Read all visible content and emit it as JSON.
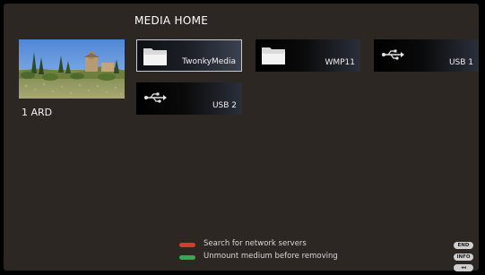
{
  "header": {
    "title": "MEDIA HOME"
  },
  "preview": {
    "channel_label": "1  ARD"
  },
  "sources": [
    {
      "label": "TwonkyMedia",
      "icon": "folder-icon",
      "selected": true
    },
    {
      "label": "WMP11",
      "icon": "folder-icon",
      "selected": false
    },
    {
      "label": "USB 1",
      "icon": "usb-icon",
      "selected": false
    },
    {
      "label": "USB 2",
      "icon": "usb-icon",
      "selected": false
    }
  ],
  "legend": {
    "red": {
      "color": "#d83a2e",
      "text": "Search for network servers"
    },
    "green": {
      "color": "#34a853",
      "text": "Unmount medium before removing"
    }
  },
  "keys": {
    "end": "END",
    "info": "INFO",
    "back": "◂◂"
  }
}
